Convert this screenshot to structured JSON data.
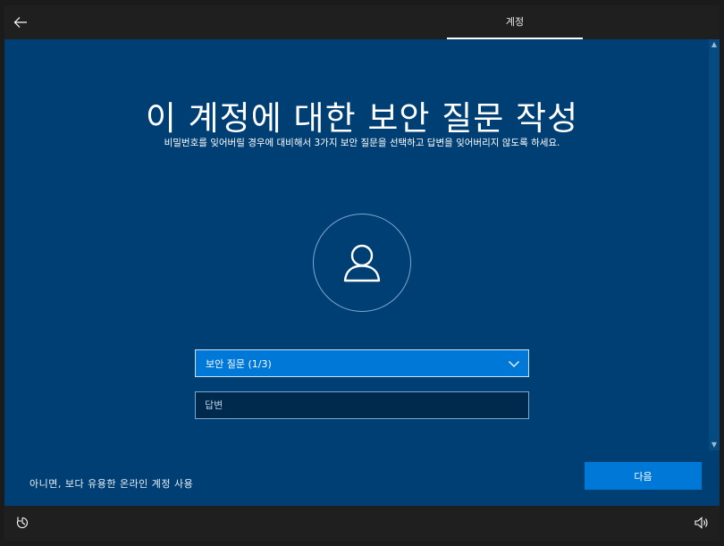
{
  "topbar": {
    "back_icon": "back-arrow-icon",
    "tab_label": "계정"
  },
  "main": {
    "title": "이 계정에 대한 보안 질문 작성",
    "subtitle": "비밀번호를 잊어버릴 경우에 대비해서 3가지 보안 질문을 선택하고 답변을 잊어버리지 않도록 하세요.",
    "avatar_icon": "user-icon",
    "security_question": {
      "selected": "보안 질문 (1/3)",
      "icon": "chevron-down-icon"
    },
    "answer": {
      "placeholder": "답변",
      "value": ""
    },
    "online_account_link": "아니면, 보다 유용한 온라인 계정 사용",
    "next_label": "다음"
  },
  "bottombar": {
    "left_icon": "ease-of-access-icon",
    "right_icon": "volume-icon"
  },
  "colors": {
    "background": "#003f73",
    "accent": "#0078d7",
    "bar": "#1f1f1f"
  }
}
